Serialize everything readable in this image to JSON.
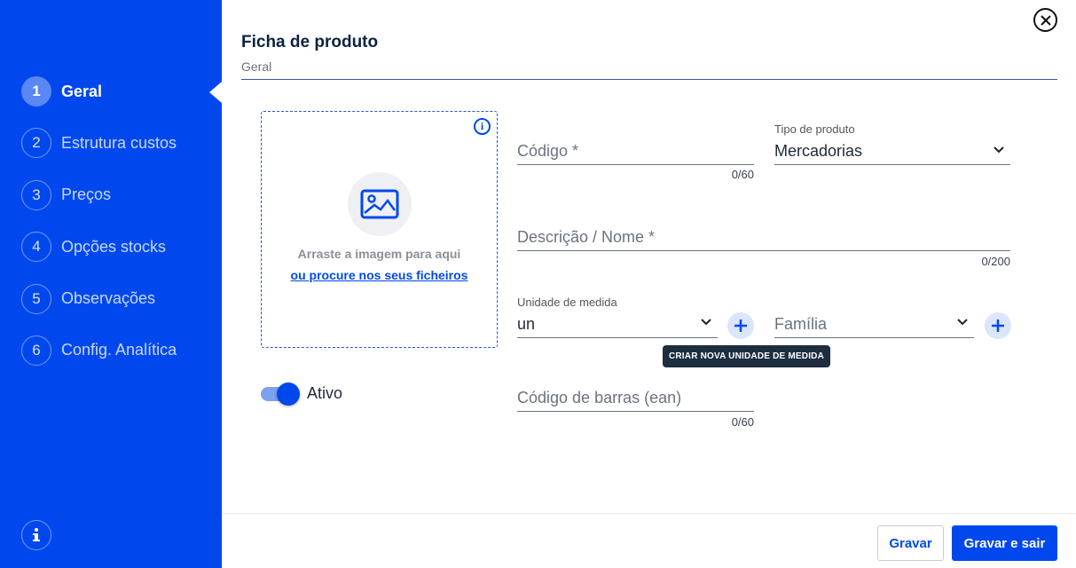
{
  "sidebar": {
    "steps": [
      {
        "num": "1",
        "label": "Geral"
      },
      {
        "num": "2",
        "label": "Estrutura custos"
      },
      {
        "num": "3",
        "label": "Preços"
      },
      {
        "num": "4",
        "label": "Opções stocks"
      },
      {
        "num": "5",
        "label": "Observações"
      },
      {
        "num": "6",
        "label": "Config. Analítica"
      }
    ],
    "active_step": "1",
    "accent_color": "#0048ee"
  },
  "header": {
    "title": "Ficha de produto",
    "subtitle": "Geral"
  },
  "image_upload": {
    "drag_text": "Arraste a imagem para aqui",
    "browse_link": "ou procure nos seus ficheiros"
  },
  "active_toggle": {
    "label": "Ativo",
    "on": true
  },
  "form": {
    "codigo": {
      "placeholder": "Código *",
      "counter": "0/60"
    },
    "tipo_produto": {
      "label": "Tipo de produto",
      "value": "Mercadorias"
    },
    "descricao": {
      "placeholder": "Descrição / Nome *",
      "counter": "0/200"
    },
    "unidade": {
      "label": "Unidade de medida",
      "value": "un"
    },
    "familia": {
      "placeholder": "Família"
    },
    "codigo_barras": {
      "placeholder": "Código de barras (ean)",
      "counter": "0/60"
    }
  },
  "tooltip": "CRIAR NOVA UNIDADE DE MEDIDA",
  "footer": {
    "save_label": "Gravar",
    "save_exit_label": "Gravar e sair"
  }
}
